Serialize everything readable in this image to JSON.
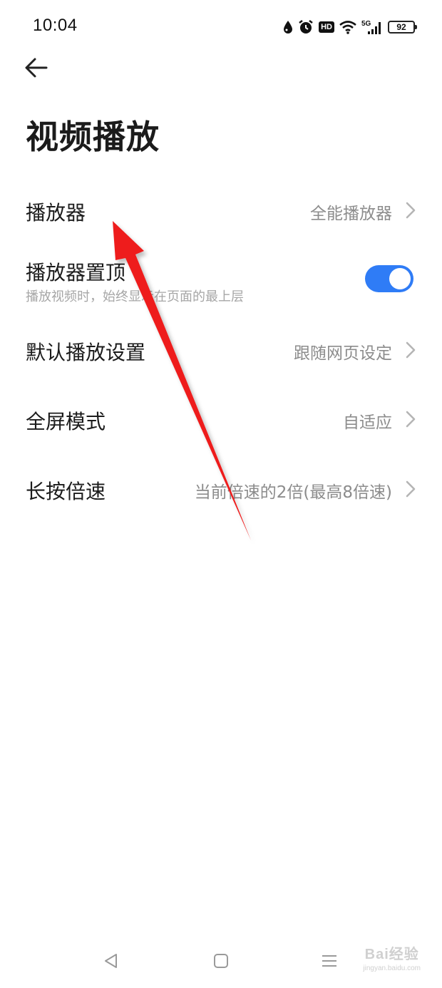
{
  "status_bar": {
    "time": "10:04",
    "icons": [
      "water-drop-icon",
      "alarm-icon",
      "hd-icon",
      "wifi-icon",
      "5g-signal-icon",
      "battery-icon"
    ],
    "hd_label": "HD",
    "network_label": "5G",
    "battery_level": "92"
  },
  "header": {
    "back_icon": "back-arrow-icon",
    "title": "视频播放"
  },
  "settings": [
    {
      "label": "播放器",
      "value": "全能播放器",
      "type": "link"
    },
    {
      "label": "播放器置顶",
      "subtitle": "播放视频时，始终显示在页面的最上层",
      "type": "toggle",
      "enabled": true
    },
    {
      "label": "默认播放设置",
      "value": "跟随网页设定",
      "type": "link"
    },
    {
      "label": "全屏模式",
      "value": "自适应",
      "type": "link"
    },
    {
      "label": "长按倍速",
      "value": "当前倍速的2倍(最高8倍速)",
      "type": "link"
    }
  ],
  "colors": {
    "toggle_on": "#2f7cf6",
    "annotation_arrow": "#ee1c1c",
    "value_text": "#8c8c8c"
  },
  "annotation": {
    "type": "red-arrow",
    "points_to": "播放器"
  },
  "nav_bar": {
    "buttons": [
      "back-triangle-icon",
      "home-square-icon",
      "recents-menu-icon"
    ]
  },
  "watermark": {
    "main": "Bai经验",
    "sub": "jingyan.baidu.com"
  }
}
